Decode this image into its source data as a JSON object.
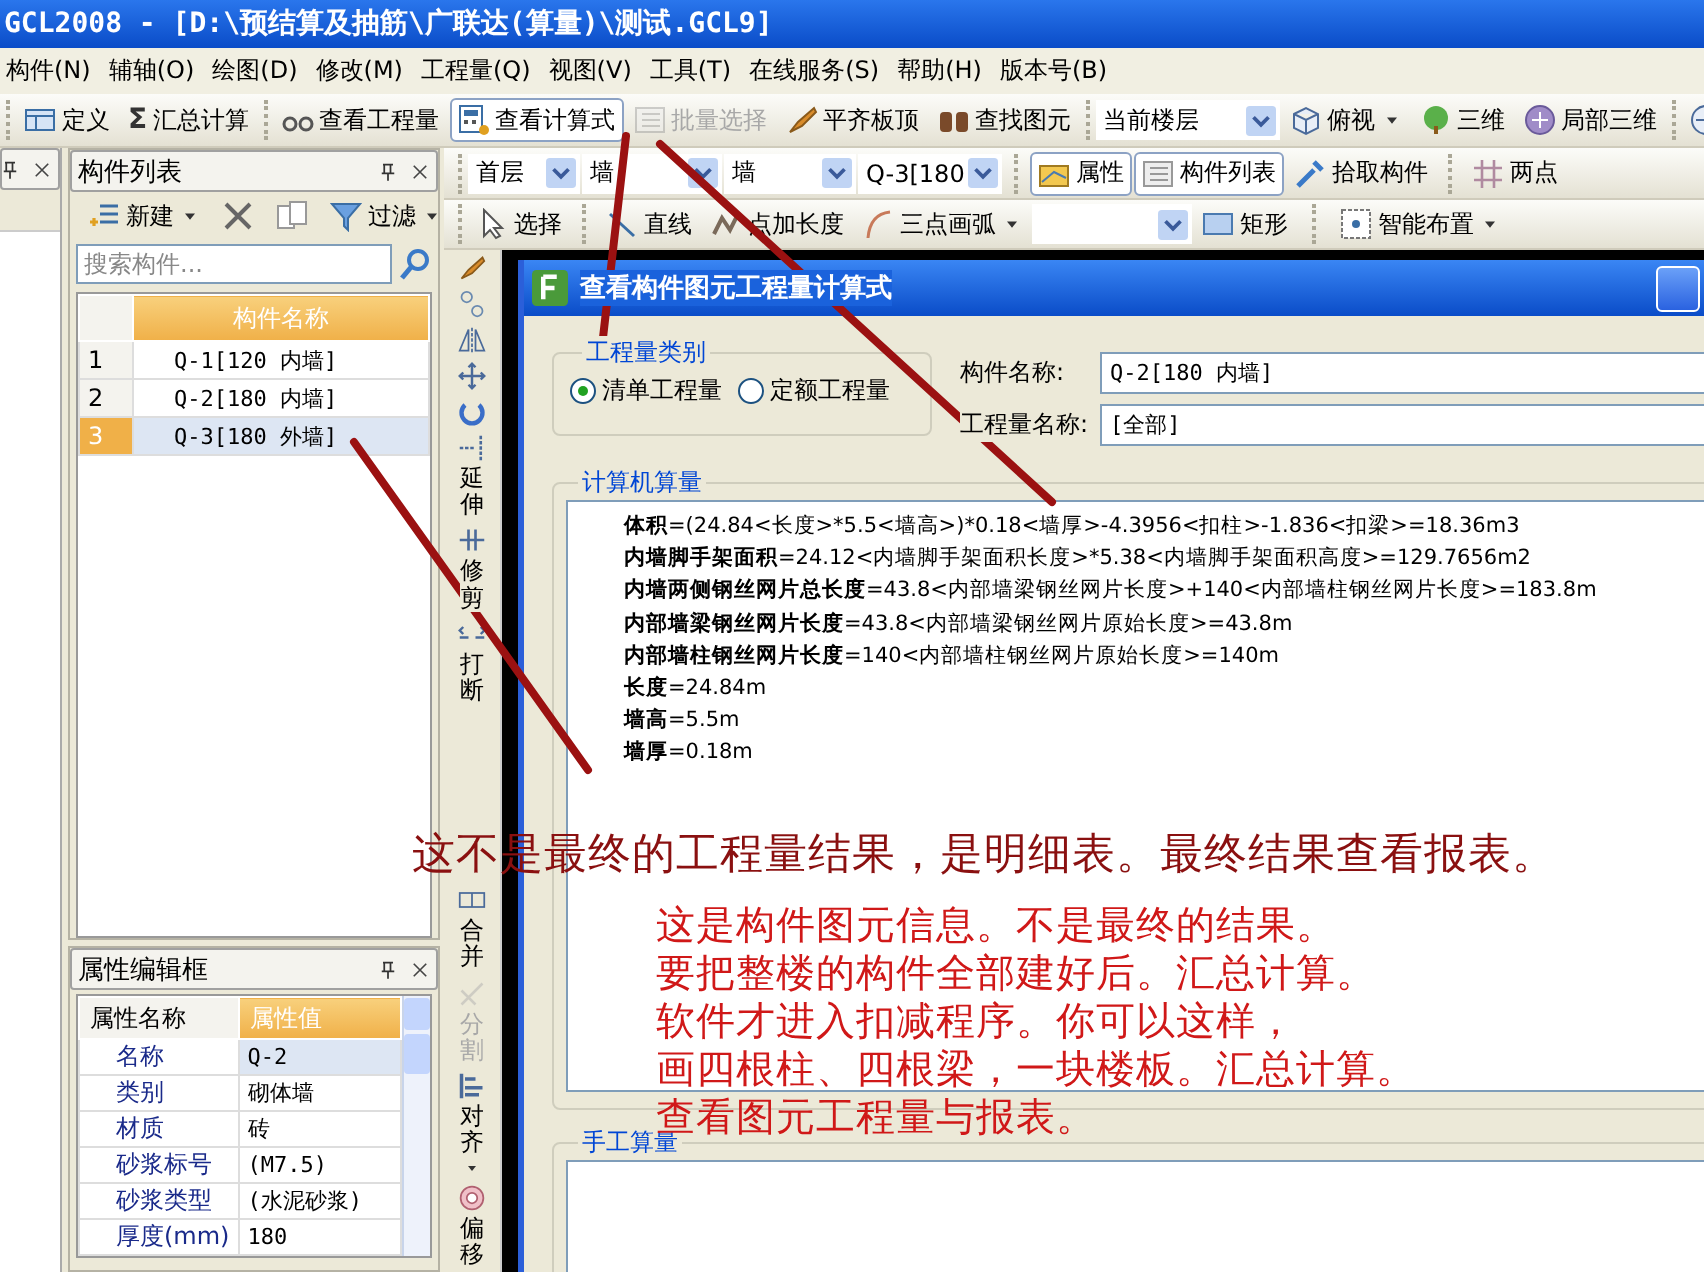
{
  "window": {
    "title": "GCL2008 - [D:\\预结算及抽筋\\广联达(算量)\\测试.GCL9]"
  },
  "menu": [
    "构件(N)",
    "辅轴(O)",
    "绘图(D)",
    "修改(M)",
    "工程量(Q)",
    "视图(V)",
    "工具(T)",
    "在线服务(S)",
    "帮助(H)",
    "版本号(B)"
  ],
  "toolbar": [
    [
      {
        "kind": "button",
        "label": "定义",
        "pressed": false,
        "disabled": false,
        "caret": false
      },
      {
        "kind": "button",
        "label": "汇总计算",
        "icon_text": "Σ",
        "pressed": false,
        "disabled": false,
        "caret": false
      }
    ],
    [
      {
        "kind": "button",
        "label": "查看工程量",
        "pressed": false,
        "disabled": false,
        "caret": false
      },
      {
        "kind": "button",
        "label": "查看计算式",
        "pressed": true,
        "disabled": false,
        "caret": false
      },
      {
        "kind": "button",
        "label": "批量选择",
        "pressed": false,
        "disabled": true,
        "caret": false
      },
      {
        "kind": "button",
        "label": "平齐板顶",
        "pressed": false,
        "disabled": false,
        "caret": false
      },
      {
        "kind": "button",
        "label": "查找图元",
        "pressed": false,
        "disabled": false,
        "caret": false
      }
    ],
    [
      {
        "kind": "dropdown",
        "label": "当前楼层",
        "pressed": false,
        "disabled": false,
        "caret": false
      },
      {
        "kind": "button",
        "label": "俯视",
        "pressed": false,
        "disabled": false,
        "caret": true
      },
      {
        "kind": "button",
        "label": "三维",
        "pressed": false,
        "disabled": false,
        "caret": false
      },
      {
        "kind": "button",
        "label": "局部三维",
        "pressed": false,
        "disabled": false,
        "caret": false
      }
    ],
    [
      {
        "kind": "button",
        "pressed": false,
        "disabled": false,
        "caret": false
      }
    ]
  ],
  "draw_toolbar": [
    [
      {
        "kind": "dropdown",
        "label": "首层",
        "pressed": false,
        "disabled": false,
        "caret": false
      },
      {
        "kind": "dropdown",
        "label": "墙",
        "pressed": false,
        "disabled": false,
        "caret": false
      },
      {
        "kind": "dropdown",
        "label": "墙",
        "pressed": false,
        "disabled": false,
        "caret": false
      },
      {
        "kind": "dropdown",
        "label": "Q-3[180",
        "pressed": false,
        "disabled": false,
        "caret": false
      }
    ],
    [
      {
        "kind": "button",
        "label": "属性",
        "pressed": true,
        "disabled": false,
        "caret": false
      },
      {
        "kind": "button",
        "label": "构件列表",
        "pressed": true,
        "disabled": false,
        "caret": false
      },
      {
        "kind": "button",
        "label": "拾取构件",
        "pressed": false,
        "disabled": false,
        "caret": false
      }
    ],
    [
      {
        "kind": "button",
        "label": "两点",
        "pressed": false,
        "disabled": false,
        "caret": false
      }
    ]
  ],
  "shape_toolbar": [
    [
      {
        "kind": "button",
        "label": "选择",
        "pressed": false,
        "disabled": false,
        "caret": false
      }
    ],
    [
      {
        "kind": "button",
        "label": "直线",
        "pressed": false,
        "disabled": false,
        "caret": false
      },
      {
        "kind": "button",
        "label": "点加长度",
        "pressed": false,
        "disabled": false,
        "caret": false
      },
      {
        "kind": "button",
        "label": "三点画弧",
        "pressed": false,
        "disabled": false,
        "caret": true
      },
      {
        "kind": "dropdown",
        "pressed": false,
        "disabled": false,
        "caret": false
      },
      {
        "kind": "button",
        "label": "矩形",
        "pressed": false,
        "disabled": false,
        "caret": false
      }
    ],
    [
      {
        "kind": "button",
        "label": "智能布置",
        "pressed": false,
        "disabled": false,
        "caret": true
      }
    ]
  ],
  "component_list": {
    "title": "构件列表",
    "tools": [
      {
        "label": "新建",
        "caret": true
      },
      {
        "caret": false
      },
      {
        "caret": false
      },
      {
        "label": "过滤",
        "caret": true
      }
    ],
    "search": {
      "placeholder": "搜索构件..."
    },
    "columns": [
      "构件名称"
    ],
    "rows": [
      {
        "index": "1",
        "name": "Q-1[120 内墙]",
        "selected": false
      },
      {
        "index": "2",
        "name": "Q-2[180 内墙]",
        "selected": false
      },
      {
        "index": "3",
        "name": "Q-3[180 外墙]",
        "selected": true
      }
    ]
  },
  "property_editor": {
    "title": "属性编辑框",
    "columns": [
      "属性名称",
      "属性值"
    ],
    "rows": [
      {
        "name": "名称",
        "value": "Q-2",
        "selected": true
      },
      {
        "name": "类别",
        "value": "砌体墙",
        "selected": false
      },
      {
        "name": "材质",
        "value": "砖",
        "selected": false
      },
      {
        "name": "砂浆标号",
        "value": "(M7.5)",
        "selected": false
      },
      {
        "name": "砂浆类型",
        "value": "(水泥砂浆)",
        "selected": false
      },
      {
        "name": "厚度(mm)",
        "value": "180",
        "selected": false
      }
    ]
  },
  "edit_toolbar": [
    {
      "disabled": false,
      "caret": false
    },
    {
      "disabled": false,
      "caret": false
    },
    {
      "disabled": false,
      "caret": false
    },
    {
      "disabled": false,
      "caret": false
    },
    {
      "disabled": false,
      "caret": false
    },
    {
      "label": "延伸",
      "disabled": false,
      "caret": false
    },
    {
      "label": "修剪",
      "disabled": false,
      "caret": false
    },
    {
      "label": "打断",
      "disabled": false,
      "caret": false
    },
    {
      "label": "合并",
      "disabled": false,
      "caret": false
    },
    {
      "label": "分割",
      "disabled": true,
      "caret": false
    },
    {
      "label": "对齐",
      "disabled": false,
      "caret": true
    },
    {
      "label": "偏移",
      "disabled": false,
      "caret": false
    }
  ],
  "dialog": {
    "title": "查看构件图元工程量计算式",
    "quantity_type": {
      "label": "工程量类别",
      "options": [
        {
          "label": "清单工程量",
          "selected": true
        },
        {
          "label": "定额工程量",
          "selected": false
        }
      ]
    },
    "fields": [
      {
        "label": "构件名称:",
        "value": "Q-2[180 内墙]"
      },
      {
        "label": "工程量名称:",
        "value": "[全部]"
      }
    ],
    "computed": {
      "label": "计算机算量",
      "lines": [
        "**体积**=(24.84<长度>*5.5<墙高>)*0.18<墙厚>-4.3956<扣柱>-1.836<扣梁>=18.36m3",
        "**内墙脚手架面积**=24.12<内墙脚手架面积长度>*5.38<内墙脚手架面积高度>=129.7656m2",
        "**内墙两侧钢丝网片总长度**=43.8<内部墙梁钢丝网片长度>+140<内部墙柱钢丝网片长度>=183.8m",
        "**内部墙梁钢丝网片长度**=43.8<内部墙梁钢丝网片原始长度>=43.8m",
        "**内部墙柱钢丝网片长度**=140<内部墙柱钢丝网片原始长度>=140m",
        "**长度**=24.84m",
        "**墙高**=5.5m",
        "**墙厚**=0.18m"
      ]
    },
    "manual": {
      "label": "手工算量"
    }
  },
  "annotations": {
    "note": "这不是最终的工程量结果，是明细表。最终结果查看报表。",
    "paragraph": [
      "这是构件图元信息。不是最终的结果。",
      "要把整楼的构件全部建好后。汇总计算。",
      "软件才进入扣减程序。你可以这样，",
      "画四根柱、四根梁，一块楼板。汇总计算。",
      "查看图元工程量与报表。"
    ]
  }
}
